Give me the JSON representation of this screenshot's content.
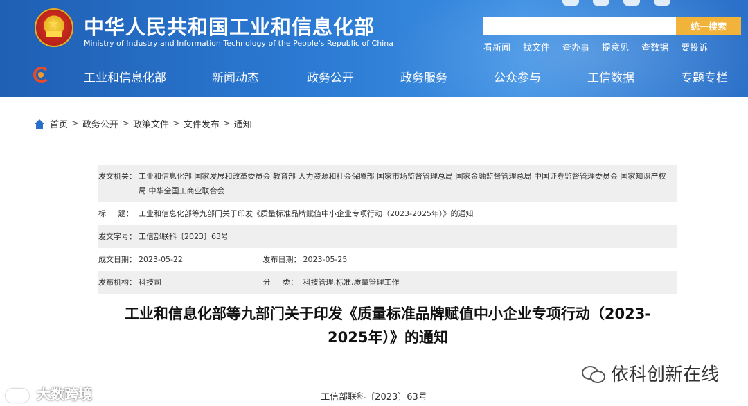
{
  "header": {
    "title_cn": "中华人民共和国工业和信息化部",
    "title_en": "Ministry of Industry and Information Technology of the People's Republic of China",
    "search_placeholder": "",
    "search_button": "统一搜索",
    "quick_links": [
      "看新闻",
      "找文件",
      "查办事",
      "提意见",
      "查数据",
      "要投诉"
    ]
  },
  "nav": {
    "items": [
      "工业和信息化部",
      "新闻动态",
      "政务公开",
      "政务服务",
      "公众参与",
      "工信数据",
      "专题专栏"
    ]
  },
  "breadcrumb": [
    "首页",
    "政务公开",
    "政策文件",
    "文件发布",
    "通知"
  ],
  "breadcrumb_sep": ">",
  "meta": {
    "issuer_label": "发文机关：",
    "issuer_line1": "工业和信息化部 国家发展和改革委员会 教育部 人力资源和社会保障部 国家市场监督管理总局 国家金融监督管理总局 中国证券监督管理委员会 国家知识产权",
    "issuer_line2": "局 中华全国工商业联合会",
    "title_label": "标     题：",
    "title_value": "工业和信息化部等九部门关于印发《质量标准品牌赋值中小企业专项行动（2023-2025年）》的通知",
    "docno_label": "发文字号：",
    "docno_value": "工信部联科〔2023〕63号",
    "created_label": "成文日期：",
    "created_value": "2023-05-22",
    "published_label": "发布日期：",
    "published_value": "2023-05-25",
    "org_label": "发布机构：",
    "org_value": "科技司",
    "category_label": "分     类：",
    "category_value": "科技管理,标准,质量管理工作"
  },
  "document": {
    "title_line1": "工业和信息化部等九部门关于印发《质量标准品牌赋值中小企业专项行动（2023-",
    "title_line2": "2025年）》的通知",
    "doc_number": "工信部联科〔2023〕63号"
  },
  "watermarks": {
    "left": "大数跨境",
    "right": "依科创新在线"
  },
  "colors": {
    "header_blue": "#2b79d2",
    "search_button": "#f2b33b",
    "breadcrumb_home": "#2a6fc8",
    "meta_shade": "#efefef"
  }
}
